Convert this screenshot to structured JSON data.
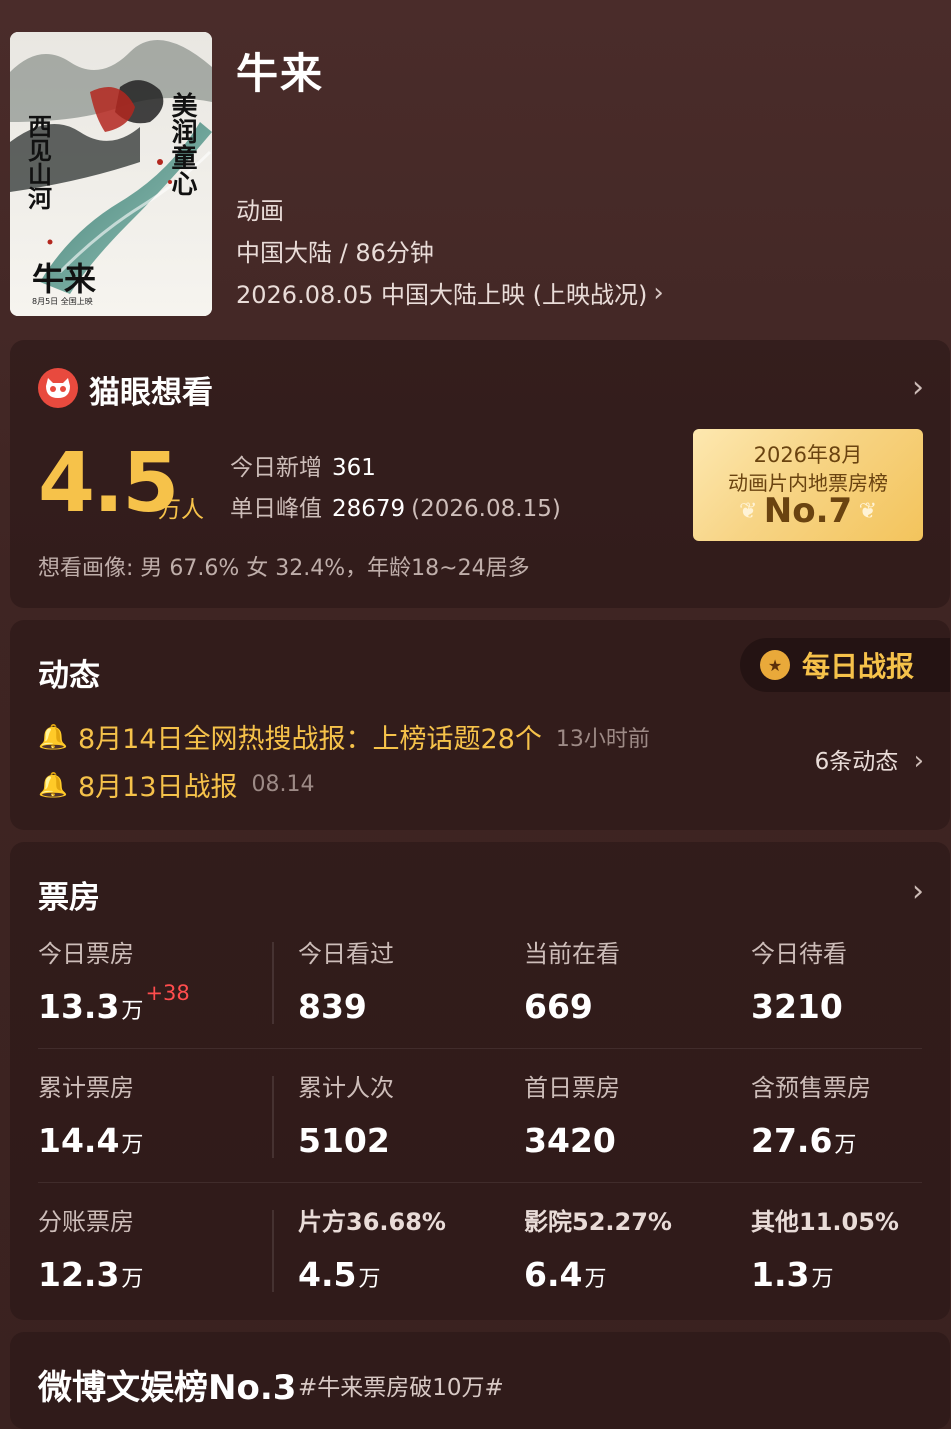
{
  "movie": {
    "title": "牛来",
    "genre": "动画",
    "region_duration": "中国大陆 / 86分钟",
    "release": "2026.08.05 中国大陆上映 (上映战况)",
    "poster": {
      "left_calligraphy": "西见山河",
      "right_calligraphy": "美润童心",
      "title_mark": "牛来",
      "date_line": "8月5日 全国上映"
    }
  },
  "want": {
    "title": "猫眼想看",
    "count_value": "4.5",
    "count_unit": "万人",
    "today_label": "今日新增",
    "today_value": "361",
    "peak_label": "单日峰值",
    "peak_value": "28679",
    "peak_date": "(2026.08.15)",
    "portrait": "想看画像: 男 67.6%  女 32.4%，年龄18~24居多",
    "rank": {
      "line1": "2026年8月",
      "line2": "动画片内地票房榜",
      "line3": "No.7"
    }
  },
  "news": {
    "title": "动态",
    "daily_label": "每日战报",
    "items": [
      {
        "text": "8月14日全网热搜战报：上榜话题28个",
        "time": "13小时前"
      },
      {
        "text": "8月13日战报",
        "time": "08.14"
      }
    ],
    "count_label": "6条动态"
  },
  "box": {
    "title": "票房",
    "rows": [
      [
        {
          "label": "今日票房",
          "value": "13.3",
          "unit": "万",
          "inc": "+38"
        },
        {
          "label": "今日看过",
          "value": "839"
        },
        {
          "label": "当前在看",
          "value": "669"
        },
        {
          "label": "今日待看",
          "value": "3210"
        }
      ],
      [
        {
          "label": "累计票房",
          "value": "14.4",
          "unit": "万"
        },
        {
          "label": "累计人次",
          "value": "5102"
        },
        {
          "label": "首日票房",
          "value": "3420"
        },
        {
          "label": "含预售票房",
          "value": "27.6",
          "unit": "万"
        }
      ],
      [
        {
          "label": "分账票房",
          "value": "12.3",
          "unit": "万"
        },
        {
          "label": "片方36.68%",
          "value": "4.5",
          "unit": "万"
        },
        {
          "label": "影院52.27%",
          "value": "6.4",
          "unit": "万"
        },
        {
          "label": "其他11.05%",
          "value": "1.3",
          "unit": "万"
        }
      ]
    ]
  },
  "weibo": {
    "title": "微博文娱榜No.3",
    "tag": "#牛来票房破10万#"
  },
  "icons": {
    "arrow": "chevron-right-icon",
    "bell": "bell-icon",
    "medal": "medal-icon",
    "cat": "maoyan-cat-icon"
  },
  "colors": {
    "accent_gold": "#f6c24a",
    "increase_red": "#ff4d4d",
    "background": "#4a2c2a"
  }
}
